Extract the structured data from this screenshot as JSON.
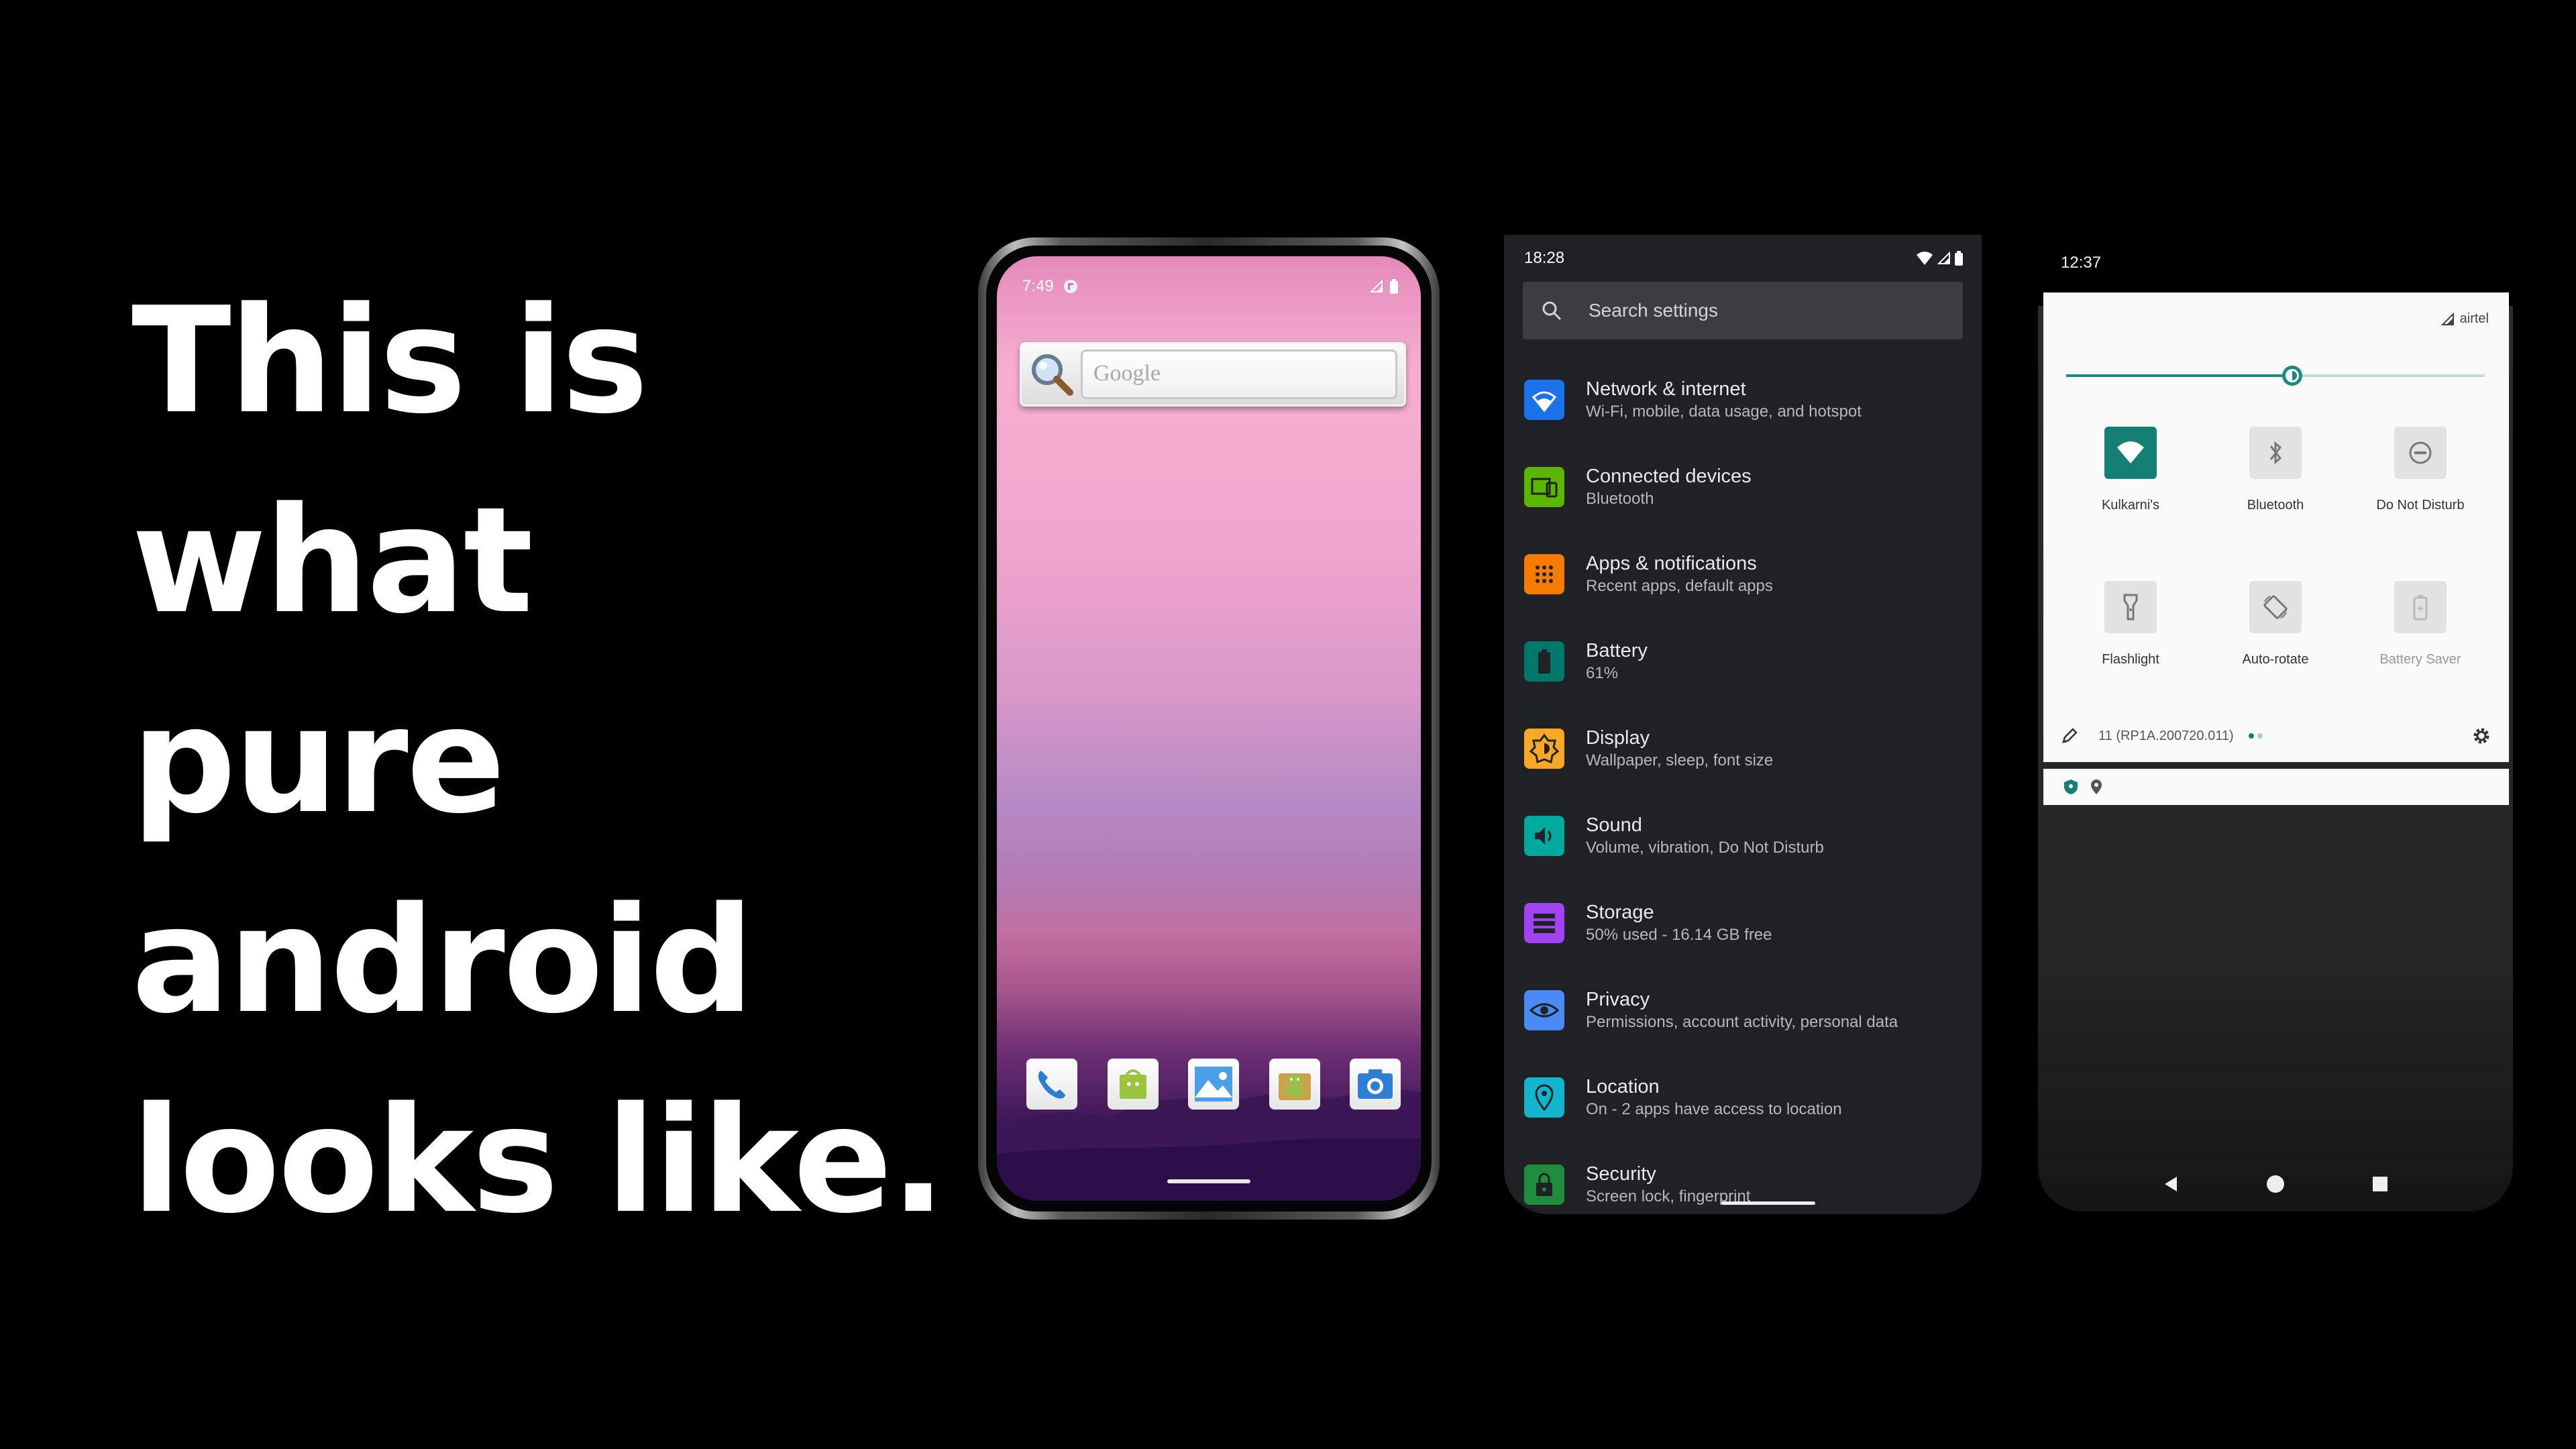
{
  "headline": {
    "line1": "This is",
    "line2": "what",
    "line3": "pure",
    "line4": "android",
    "line5": "looks like."
  },
  "home_screen": {
    "status_time": "7:49",
    "search_placeholder": "Google",
    "dock_apps": [
      "phone-icon",
      "market-icon",
      "gallery-icon",
      "android-market-icon",
      "camera-icon"
    ]
  },
  "settings_screen": {
    "status_time": "18:28",
    "search_label": "Search settings",
    "items": [
      {
        "title": "Network & internet",
        "subtitle": "Wi-Fi, mobile, data usage, and hotspot",
        "icon": "wifi-icon",
        "color": "#1a73e8"
      },
      {
        "title": "Connected devices",
        "subtitle": "Bluetooth",
        "icon": "devices-icon",
        "color": "#5bb600"
      },
      {
        "title": "Apps & notifications",
        "subtitle": "Recent apps, default apps",
        "icon": "apps-icon",
        "color": "#f57c00"
      },
      {
        "title": "Battery",
        "subtitle": "61%",
        "icon": "battery-icon",
        "color": "#00796b"
      },
      {
        "title": "Display",
        "subtitle": "Wallpaper, sleep, font size",
        "icon": "display-icon",
        "color": "#f9a825"
      },
      {
        "title": "Sound",
        "subtitle": "Volume, vibration, Do Not Disturb",
        "icon": "sound-icon",
        "color": "#00a99d"
      },
      {
        "title": "Storage",
        "subtitle": "50% used - 16.14 GB free",
        "icon": "storage-icon",
        "color": "#a142f4"
      },
      {
        "title": "Privacy",
        "subtitle": "Permissions, account activity, personal data",
        "icon": "privacy-icon",
        "color": "#4a8af4"
      },
      {
        "title": "Location",
        "subtitle": "On - 2 apps have access to location",
        "icon": "location-icon",
        "color": "#12b5cb"
      },
      {
        "title": "Security",
        "subtitle": "Screen lock, fingerprint",
        "icon": "lock-icon",
        "color": "#1e8e3e"
      }
    ]
  },
  "quick_settings": {
    "status_time": "12:37",
    "carrier": "airtel",
    "brightness_level": 0.54,
    "tiles": [
      {
        "label": "Kulkarni's",
        "icon": "wifi-icon",
        "active": true
      },
      {
        "label": "Bluetooth",
        "icon": "bluetooth-icon",
        "active": false
      },
      {
        "label": "Do Not Disturb",
        "icon": "dnd-icon",
        "active": false
      },
      {
        "label": "Flashlight",
        "icon": "flashlight-icon",
        "active": false
      },
      {
        "label": "Auto-rotate",
        "icon": "rotate-icon",
        "active": false
      },
      {
        "label": "Battery Saver",
        "icon": "battery-saver-icon",
        "active": false,
        "disabled": true
      }
    ],
    "build_number": "11 (RP1A.200720.011)",
    "accent": "#137f75"
  }
}
